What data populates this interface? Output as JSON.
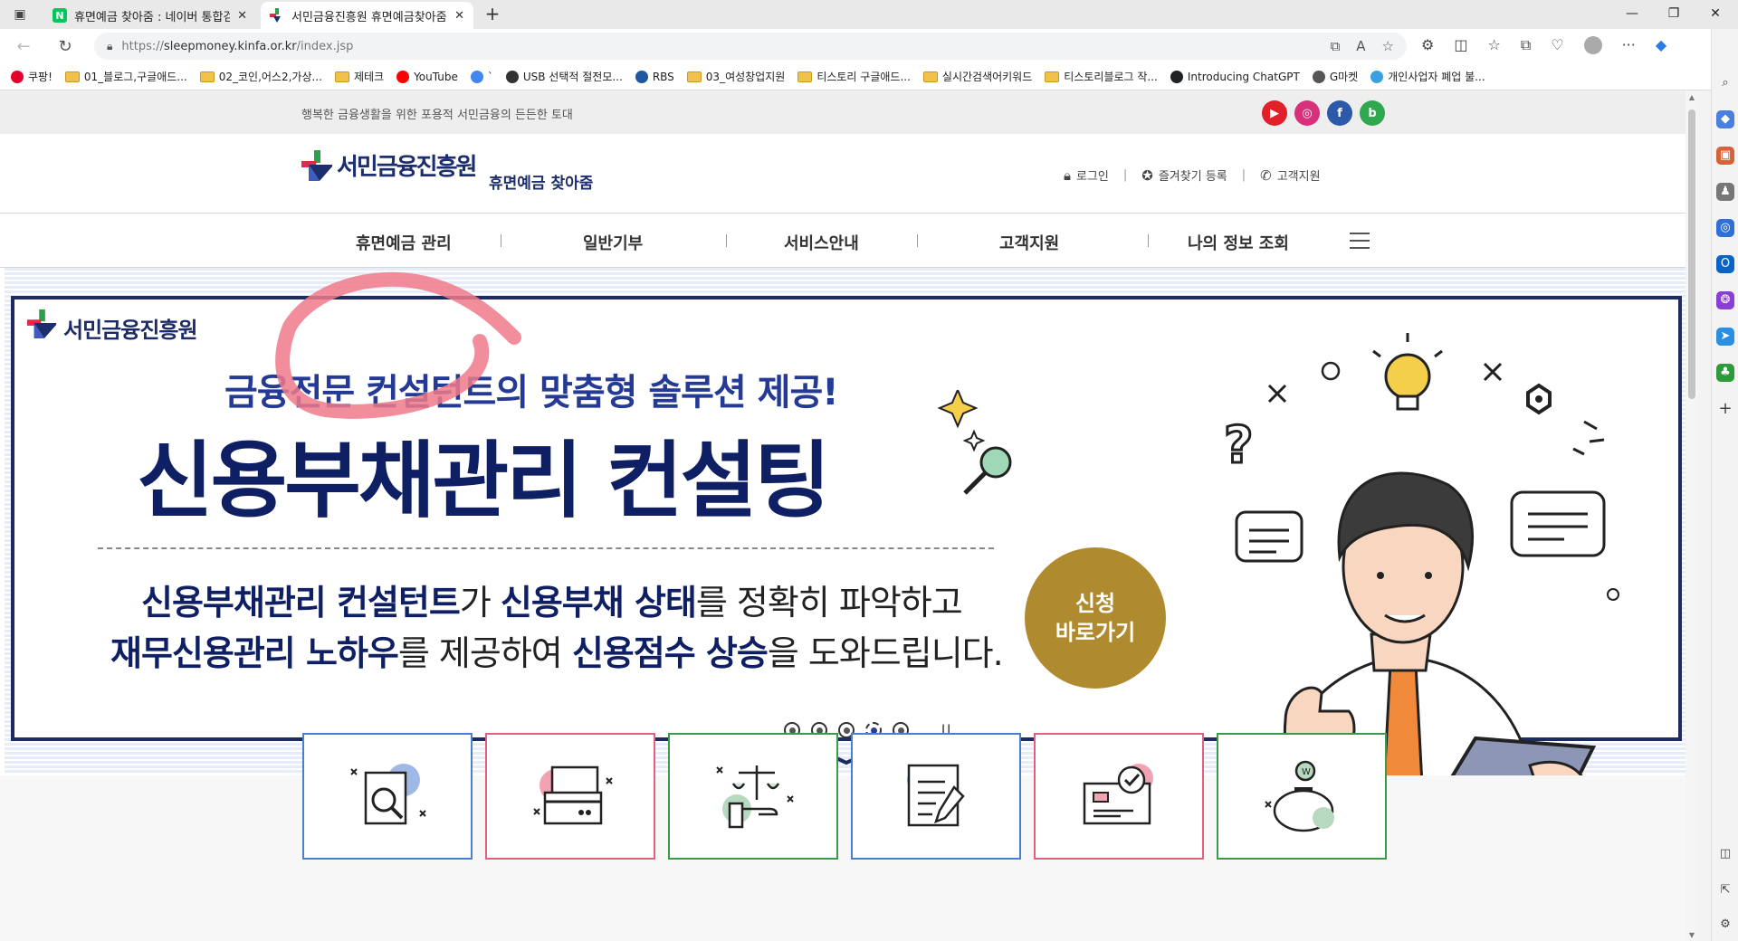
{
  "browser": {
    "tabs": [
      {
        "title": "휴면예금 찾아줌 : 네이버 통합검",
        "favicon": "N",
        "active": false
      },
      {
        "title": "서민금융진흥원 휴면예금찾아줌",
        "favicon": "kinfa",
        "active": true
      }
    ],
    "url_prefix": "https://",
    "url_host": "sleepmoney.kinfa.or.kr",
    "url_path": "/index.jsp",
    "bookmarks": [
      {
        "label": "쿠팡!",
        "type": "site",
        "color": "#e4002b"
      },
      {
        "label": "01_블로그,구글애드...",
        "type": "folder"
      },
      {
        "label": "02_코인,어스2,가상...",
        "type": "folder"
      },
      {
        "label": "제테크",
        "type": "folder"
      },
      {
        "label": "YouTube",
        "type": "site",
        "color": "#ff0000"
      },
      {
        "label": "`",
        "type": "site",
        "color": "#4285f4"
      },
      {
        "label": "USB 선택적 절전모...",
        "type": "site",
        "color": "#333333"
      },
      {
        "label": "RBS",
        "type": "site",
        "color": "#1e56a0"
      },
      {
        "label": "03_여성창업지원",
        "type": "folder"
      },
      {
        "label": "티스토리 구글애드...",
        "type": "folder"
      },
      {
        "label": "실시간검색어키워드",
        "type": "folder"
      },
      {
        "label": "티스토리블로그 작...",
        "type": "folder"
      },
      {
        "label": "Introducing ChatGPT",
        "type": "site",
        "color": "#202123"
      },
      {
        "label": "G마켓",
        "type": "site",
        "color": "#555555"
      },
      {
        "label": "개인사업자 폐업 불...",
        "type": "site",
        "color": "#3aa0e0"
      }
    ]
  },
  "site": {
    "tagline": "행복한 금융생활을 위한 포용적 서민금융의 든든한 토대",
    "sns": [
      "youtube-icon",
      "instagram-icon",
      "facebook-icon",
      "blog-icon"
    ],
    "logo_text": "서민금융진흥원",
    "logo_sub": "휴면예금 찾아줌",
    "util": {
      "login": "로그인",
      "favorite": "즐겨찾기 등록",
      "support": "고객지원"
    },
    "gnb": [
      "휴면예금 관리",
      "일반기부",
      "서비스안내",
      "고객지원",
      "나의 정보 조회"
    ]
  },
  "banner": {
    "logo_text": "서민금융진흥원",
    "subtitle": "금융전문 컨설턴트의 맞춤형 솔루션 제공!",
    "title": "신용부채관리 컨설팅",
    "line1": [
      {
        "text": "신용부채관리 컨설턴트",
        "bold": true
      },
      {
        "text": "가 ",
        "bold": false
      },
      {
        "text": "신용부채 상태",
        "bold": true
      },
      {
        "text": "를 정확히 파악하고",
        "bold": false
      }
    ],
    "line2": [
      {
        "text": "재무신용관리 노하우",
        "bold": true
      },
      {
        "text": "를 제공하여 ",
        "bold": false
      },
      {
        "text": "신용점수 상승",
        "bold": true
      },
      {
        "text": "을 도와드립니다.",
        "bold": false
      }
    ],
    "apply_line1": "신청",
    "apply_line2": "바로가기",
    "slides": 5,
    "active_slide": 4,
    "pause_label": "II"
  },
  "cards": [
    {
      "name": "search-document",
      "border": "#4a7fd0"
    },
    {
      "name": "card-payment",
      "border": "#e0607e"
    },
    {
      "name": "scale-hand",
      "border": "#3c9a4a"
    },
    {
      "name": "document-pen",
      "border": "#4a7fd0"
    },
    {
      "name": "card-check",
      "border": "#e0607e"
    },
    {
      "name": "piggy-bank",
      "border": "#3c9a4a"
    }
  ],
  "colors": {
    "brand_navy": "#1c2b66",
    "apply_gold": "#b08a2e",
    "annotation_pink": "#f07a8a"
  }
}
